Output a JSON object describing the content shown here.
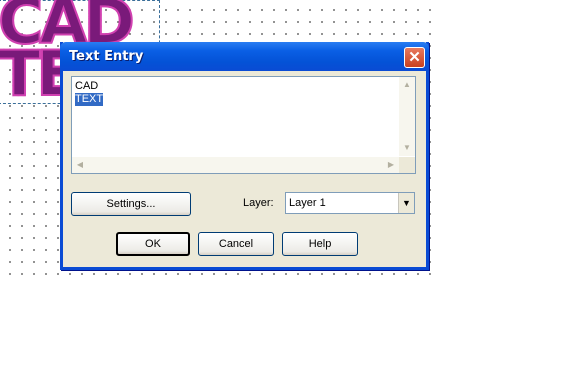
{
  "canvas": {
    "art_lines": [
      "CAD",
      "TEXT"
    ]
  },
  "dialog": {
    "title": "Text Entry",
    "close_glyph": "✕",
    "text_area": {
      "lines": [
        "CAD",
        "TEXT"
      ],
      "selected_line_index": 1
    },
    "settings_label": "Settings...",
    "layer_label": "Layer:",
    "layer_value": "Layer 1",
    "ok_label": "OK",
    "cancel_label": "Cancel",
    "help_label": "Help"
  },
  "icons": {
    "close": "close-icon",
    "scroll_up": "scroll-up-arrow-icon",
    "scroll_down": "scroll-down-arrow-icon",
    "scroll_left": "scroll-left-arrow-icon",
    "scroll_right": "scroll-right-arrow-icon",
    "dropdown": "chevron-down-icon"
  },
  "colors": {
    "titlebar": "#0a4bd4",
    "selection": "#316ac5",
    "close_button": "#c9401e",
    "art": "#7a1a7a"
  }
}
